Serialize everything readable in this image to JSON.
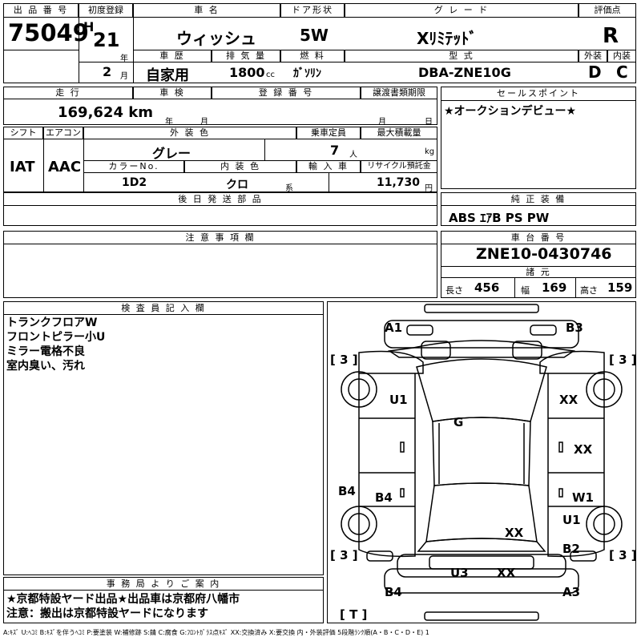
{
  "header": {
    "lot_label": "出 品 番 号",
    "lot_number": "75049",
    "first_reg_label": "初度登録",
    "era": "H",
    "year": "21",
    "year_unit": "年",
    "month": "2",
    "month_unit": "月",
    "car_name_label": "車 名",
    "car_name": "ウィッシュ",
    "door_label": "ドア形状",
    "door": "5W",
    "grade_label": "グ レ ー ド",
    "grade": "Xﾘﾐﾃｯﾄﾞ",
    "score_label": "評価点",
    "score": "R",
    "history_label": "車 歴",
    "history": "自家用",
    "displacement_label": "排 気 量",
    "displacement": "1800",
    "displacement_unit": "cc",
    "fuel_label": "燃 料",
    "fuel": "ｶﾞｿﾘﾝ",
    "model_label": "型 式",
    "model": "DBA-ZNE10G",
    "exterior_label": "外装",
    "exterior": "D",
    "interior_label": "内装",
    "interior": "C"
  },
  "row2": {
    "mileage_label": "走 行",
    "mileage": "169,624 km",
    "inspection_label": "車 検",
    "insp_year_unit": "年",
    "insp_month_unit": "月",
    "plate_label": "登 録 番 号",
    "transfer_label": "譲渡書類期限",
    "transfer_month_unit": "月",
    "transfer_day_unit": "日",
    "sales_label": "セールスポイント",
    "sales_point": "★オークションデビュー★"
  },
  "row3": {
    "shift_label": "シフト",
    "shift": "IAT",
    "ac_label": "エアコン",
    "ac": "AAC",
    "color_label": "外 装 色",
    "color": "グレー",
    "capacity_label": "乗車定員",
    "capacity": "7",
    "capacity_unit": "人",
    "load_label": "最大積載量",
    "load_unit": "kg",
    "color_no_label": "カラーNo.",
    "color_no": "1D2",
    "int_color_label": "内 装 色",
    "int_color": "クロ",
    "int_color_unit": "系",
    "import_label": "輸 入 車",
    "recycle_label": "リサイクル預託金",
    "recycle": "11,730",
    "recycle_unit": "円"
  },
  "later_parts_label": "後 日 発 送 部 品",
  "equipment_label": "純 正 装 備",
  "equipment": "ABS ｴｱB PS PW",
  "notes_label": "注 意 事 項 欄",
  "chassis_label": "車 台 番 号",
  "chassis": "ZNE10-0430746",
  "specs_label": "諸 元",
  "length_label": "長さ",
  "length": "456",
  "width_label": "幅",
  "width": "169",
  "height_label": "高さ",
  "height": "159",
  "inspector_label": "検 査 員 記 入 欄",
  "inspector_notes": [
    "トランクフロアW",
    "フロントピラー小U",
    "ミラー電格不良",
    "室内臭い、汚れ"
  ],
  "office_label": "事 務 局 よ り ご 案 内",
  "office_notes": [
    "★京都特設ヤード出品★出品車は京都府八幡市",
    "注意：搬出は京都特設ヤードになります"
  ],
  "diagram": {
    "marks": {
      "a1": "A1",
      "b3": "B3",
      "u1_left": "U1",
      "xx_right": "XX",
      "g": "G",
      "xx_door": "XX",
      "b4_side": "B4",
      "b4_door": "B4",
      "w1": "W1",
      "u1_right": "U1",
      "xx_rear": "XX",
      "b2": "B2",
      "u3": "U3",
      "xx_bumper": "XX",
      "b4_bottom": "B4",
      "a3": "A3"
    },
    "tires": [
      "3",
      "3",
      "3",
      "3"
    ],
    "spare": "T"
  },
  "legend": "A:ｷｽﾞ U:ﾍｺﾐ B:ｷｽﾞを伴うﾍｺﾐ P:要塗装 W:補修跡 S:錆 C:腐食 G:ﾌﾛﾝﾄｶﾞﾗｽ点ｷｽﾞ XX:交換済み X:要交換 内・外装評価 5段階ﾗﾝｸ順(A・B・C・D・E) 1"
}
